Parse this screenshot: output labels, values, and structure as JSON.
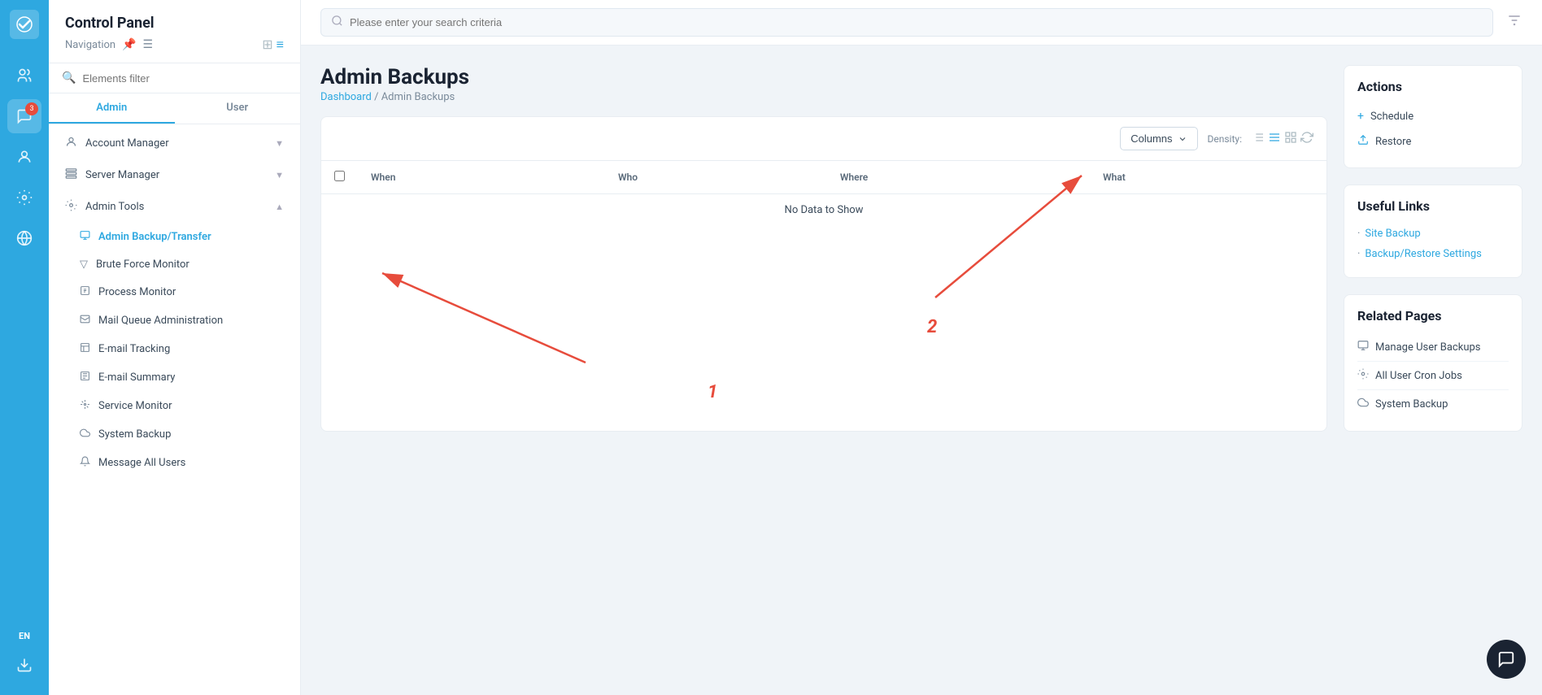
{
  "app": {
    "title": "Control Panel",
    "nav_label": "Navigation"
  },
  "search": {
    "placeholder": "Please enter your search criteria"
  },
  "breadcrumb": {
    "home": "Dashboard",
    "current": "Admin Backups"
  },
  "page": {
    "title": "Admin Backups"
  },
  "tabs": {
    "admin": "Admin",
    "user": "User"
  },
  "sidebar": {
    "filter_placeholder": "Elements filter",
    "items": [
      {
        "label": "Account Manager",
        "icon": "👤",
        "has_sub": true
      },
      {
        "label": "Server Manager",
        "icon": "🖥",
        "has_sub": true
      },
      {
        "label": "Admin Tools",
        "icon": "⚙",
        "has_sub": true,
        "expanded": true
      }
    ],
    "sub_items": [
      {
        "label": "Admin Backup/Transfer",
        "icon": "💾",
        "active": true
      },
      {
        "label": "Brute Force Monitor",
        "icon": "🔻"
      },
      {
        "label": "Process Monitor",
        "icon": "📋"
      },
      {
        "label": "Mail Queue Administration",
        "icon": "📧"
      },
      {
        "label": "E-mail Tracking",
        "icon": "📊"
      },
      {
        "label": "E-mail Summary",
        "icon": "📰"
      },
      {
        "label": "Service Monitor",
        "icon": "📡"
      },
      {
        "label": "System Backup",
        "icon": "☁"
      },
      {
        "label": "Message All Users",
        "icon": "🔔"
      }
    ]
  },
  "toolbar": {
    "columns_label": "Columns",
    "density_label": "Density:"
  },
  "table": {
    "headers": [
      "",
      "When",
      "Who",
      "Where",
      "What"
    ],
    "no_data": "No Data to Show"
  },
  "actions": {
    "title": "Actions",
    "items": [
      {
        "label": "Schedule",
        "icon": "+"
      },
      {
        "label": "Restore",
        "icon": "↥"
      }
    ]
  },
  "useful_links": {
    "title": "Useful Links",
    "items": [
      {
        "label": "Site Backup"
      },
      {
        "label": "Backup/Restore Settings"
      }
    ]
  },
  "related_pages": {
    "title": "Related Pages",
    "items": [
      {
        "label": "Manage User Backups",
        "icon": "💾"
      },
      {
        "label": "All User Cron Jobs",
        "icon": "⚙"
      },
      {
        "label": "System Backup",
        "icon": "☁"
      }
    ]
  },
  "annotations": {
    "num1": "1",
    "num2": "2"
  }
}
